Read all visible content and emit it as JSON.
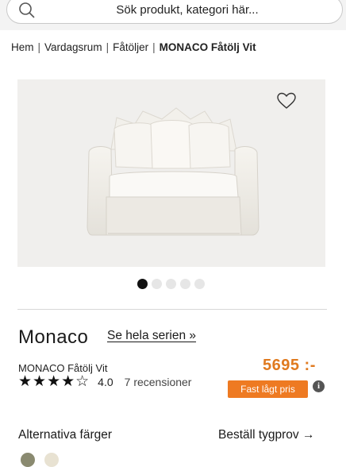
{
  "search": {
    "placeholder": "Sök produkt, kategori här..."
  },
  "breadcrumb": {
    "items": [
      "Hem",
      "Vardagsrum",
      "Fåtöljer"
    ],
    "current": "MONACO Fåtölj Vit",
    "separator": "|"
  },
  "gallery": {
    "image_count": 5,
    "active_index": 0
  },
  "product": {
    "name": "Monaco",
    "series_link": "Se hela serien »",
    "variant": "MONACO Fåtölj Vit",
    "stars": "★★★★☆",
    "rating": "4.0",
    "reviews": "7 recensioner",
    "price": "5695 :-",
    "badge": "Fast lågt pris",
    "info_icon": "i"
  },
  "options": {
    "alt_colors": "Alternativa färger",
    "fabric_sample": "Beställ tygprov →"
  },
  "colors": {
    "price": "#e07a1f",
    "badge": "#ee7a22",
    "swatches": [
      "#8a8a70",
      "#e8e2d2"
    ]
  }
}
